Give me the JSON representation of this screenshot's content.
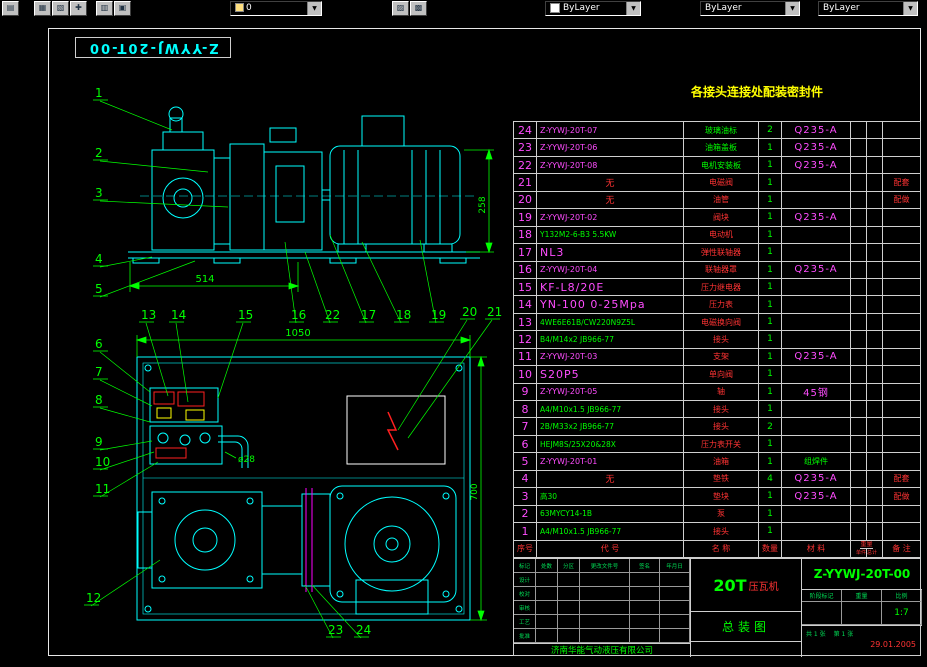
{
  "toolbar": {
    "layer_value": "0",
    "color_value": "ByLayer",
    "linetype_value": "ByLayer",
    "lineweight_value": "ByLayer"
  },
  "sheet": {
    "mirrored_number": "Z-YYWJ-20T-00",
    "seal_note": "各接头连接处配装密封件"
  },
  "dims": {
    "width_pump": "514",
    "height_side": "258",
    "length_plan": "1050",
    "width_plan": "700",
    "pipe": "ø28"
  },
  "balloons": [
    "1",
    "2",
    "3",
    "4",
    "5",
    "6",
    "7",
    "8",
    "9",
    "10",
    "11",
    "12",
    "13",
    "14",
    "15",
    "16",
    "22",
    "17",
    "18",
    "19",
    "20",
    "21",
    "23",
    "24"
  ],
  "bom": {
    "header": {
      "no": "序号",
      "code": "代  号",
      "name": "名  称",
      "qty": "数量",
      "mat": "材  料",
      "weight": "重量",
      "unit": "单件",
      "total": "总计",
      "note": "备  注"
    },
    "rows": [
      {
        "no": "24",
        "code": "Z-YYWJ-20T-07",
        "cs": "m",
        "name": "玻璃油标",
        "ns": "g",
        "qty": "2",
        "mat": "Q235-A",
        "note": ""
      },
      {
        "no": "23",
        "code": "Z-YYWJ-20T-06",
        "cs": "m",
        "name": "油箱盖板",
        "ns": "g",
        "qty": "1",
        "mat": "Q235-A",
        "note": ""
      },
      {
        "no": "22",
        "code": "Z-YYWJ-20T-08",
        "cs": "m",
        "name": "电机安装板",
        "ns": "g",
        "qty": "1",
        "mat": "Q235-A",
        "note": ""
      },
      {
        "no": "21",
        "code": "无",
        "cs": "r",
        "name": "电磁阀",
        "ns": "r",
        "qty": "1",
        "mat": "",
        "note": "配套"
      },
      {
        "no": "20",
        "code": "无",
        "cs": "r",
        "name": "油管",
        "ns": "r",
        "qty": "1",
        "mat": "",
        "note": "配做"
      },
      {
        "no": "19",
        "code": "Z-YYWJ-20T-02",
        "cs": "m",
        "name": "阀块",
        "ns": "r",
        "qty": "1",
        "mat": "Q235-A",
        "note": ""
      },
      {
        "no": "18",
        "code": "Y132M2-6-B3 5.5KW",
        "cs": "g",
        "name": "电动机",
        "ns": "r",
        "qty": "1",
        "mat": "",
        "note": ""
      },
      {
        "no": "17",
        "code": "NL3",
        "cs": "M",
        "name": "弹性联轴器",
        "ns": "r",
        "qty": "1",
        "mat": "",
        "note": ""
      },
      {
        "no": "16",
        "code": "Z-YYWJ-20T-04",
        "cs": "m",
        "name": "联轴器罩",
        "ns": "r",
        "qty": "1",
        "mat": "Q235-A",
        "note": ""
      },
      {
        "no": "15",
        "code": "KF-L8/20E",
        "cs": "M",
        "name": "压力继电器",
        "ns": "r",
        "qty": "1",
        "mat": "",
        "note": ""
      },
      {
        "no": "14",
        "code": "YN-100 0-25Mpa",
        "cs": "M",
        "name": "压力表",
        "ns": "r",
        "qty": "1",
        "mat": "",
        "note": ""
      },
      {
        "no": "13",
        "code": "4WE6E61B/CW220N9Z5L",
        "cs": "g",
        "name": "电磁换向阀",
        "ns": "r",
        "qty": "1",
        "mat": "",
        "note": ""
      },
      {
        "no": "12",
        "code": "B4/M14x2 JB966-77",
        "cs": "g",
        "name": "接头",
        "ns": "r",
        "qty": "1",
        "mat": "",
        "note": ""
      },
      {
        "no": "11",
        "code": "Z-YYWJ-20T-03",
        "cs": "m",
        "name": "支架",
        "ns": "r",
        "qty": "1",
        "mat": "Q235-A",
        "note": ""
      },
      {
        "no": "10",
        "code": "S20P5",
        "cs": "M",
        "name": "单向阀",
        "ns": "r",
        "qty": "1",
        "mat": "",
        "note": ""
      },
      {
        "no": "9",
        "code": "Z-YYWJ-20T-05",
        "cs": "m",
        "name": "轴",
        "ns": "r",
        "qty": "1",
        "mat": "45钢",
        "note": ""
      },
      {
        "no": "8",
        "code": "A4/M10x1.5 JB966-77",
        "cs": "g",
        "name": "接头",
        "ns": "r",
        "qty": "1",
        "mat": "",
        "note": ""
      },
      {
        "no": "7",
        "code": "2B/M33x2 JB966-77",
        "cs": "g",
        "name": "接头",
        "ns": "r",
        "qty": "2",
        "mat": "",
        "note": ""
      },
      {
        "no": "6",
        "code": "HEJM8S/25X20&28X",
        "cs": "g",
        "name": "压力表开关",
        "ns": "r",
        "qty": "1",
        "mat": "",
        "note": ""
      },
      {
        "no": "5",
        "code": "Z-YYWJ-20T-01",
        "cs": "m",
        "name": "油箱",
        "ns": "r",
        "qty": "1",
        "mat": "组焊件",
        "note": ""
      },
      {
        "no": "4",
        "code": "无",
        "cs": "r",
        "name": "垫铁",
        "ns": "r",
        "qty": "4",
        "mat": "Q235-A",
        "note": "配套"
      },
      {
        "no": "3",
        "code": "高30",
        "cs": "g",
        "name": "垫块",
        "ns": "r",
        "qty": "1",
        "mat": "Q235-A",
        "note": "配做"
      },
      {
        "no": "2",
        "code": "63MYCY14-1B",
        "cs": "g",
        "name": "泵",
        "ns": "r",
        "qty": "1",
        "mat": "",
        "note": ""
      },
      {
        "no": "1",
        "code": "A4/M10x1.5 JB966-77",
        "cs": "g",
        "name": "接头",
        "ns": "r",
        "qty": "1",
        "mat": "",
        "note": ""
      }
    ]
  },
  "titleblock": {
    "product": "20T",
    "product_suffix": "压瓦机",
    "number": "Z-YYWJ-20T-00",
    "sheet_name": "总装图",
    "company": "济南华能气动液压有限公司",
    "stage_label": "阶段标记",
    "weight_label": "重量",
    "scale_label": "比例",
    "scale": "1:7",
    "sheet_count": "共 1 张",
    "sheet_index": "第 1 张",
    "date": "29.01.2005",
    "sign_top": [
      "标记",
      "处数",
      "分区",
      "更改文件号",
      "签名",
      "年月日"
    ],
    "sign_rows": [
      "设计",
      "校对",
      "审核",
      "工艺",
      "批准"
    ]
  },
  "colors": {
    "line_cyan": "#00ffff",
    "annotation_green": "#00ff00",
    "table_magenta": "#ff4dff",
    "table_red": "#ff3333",
    "note_yellow": "#ffff00",
    "centerline_magenta": "#ff00ff"
  }
}
